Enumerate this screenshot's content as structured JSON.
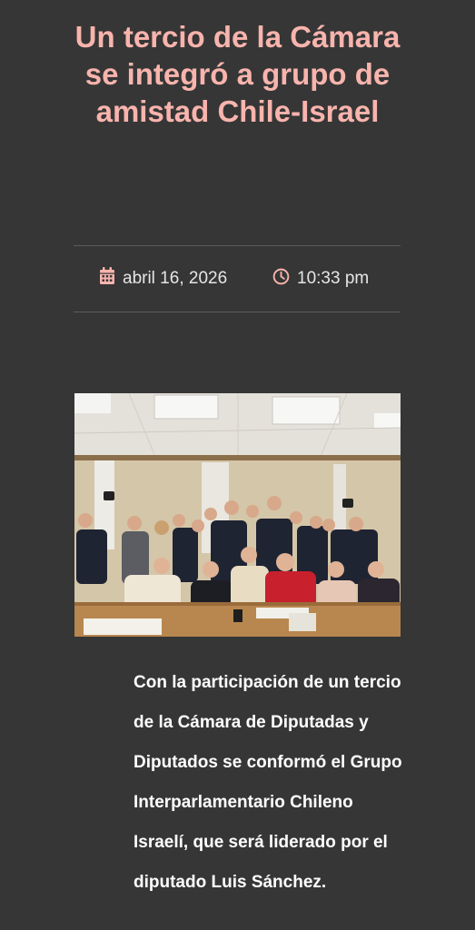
{
  "article": {
    "title": "Un tercio de la Cámara se integró a grupo de amistad Chile-Israel",
    "date": "abril 16, 2026",
    "time": "10:33 pm",
    "body": "Con la participación de un tercio de la Cámara de Diputadas y Diputados se conformó el Grupo Interparlamentario Chileno Israelí, que será liderado por el diputado Luis Sánchez."
  },
  "icons": {
    "date": "calendar-icon",
    "time": "clock-icon"
  },
  "colors": {
    "background": "#363636",
    "title": "#f8b4ad",
    "meta_text": "#e6e6e6",
    "body_text": "#ffffff",
    "divider": "#5c5c5c"
  }
}
